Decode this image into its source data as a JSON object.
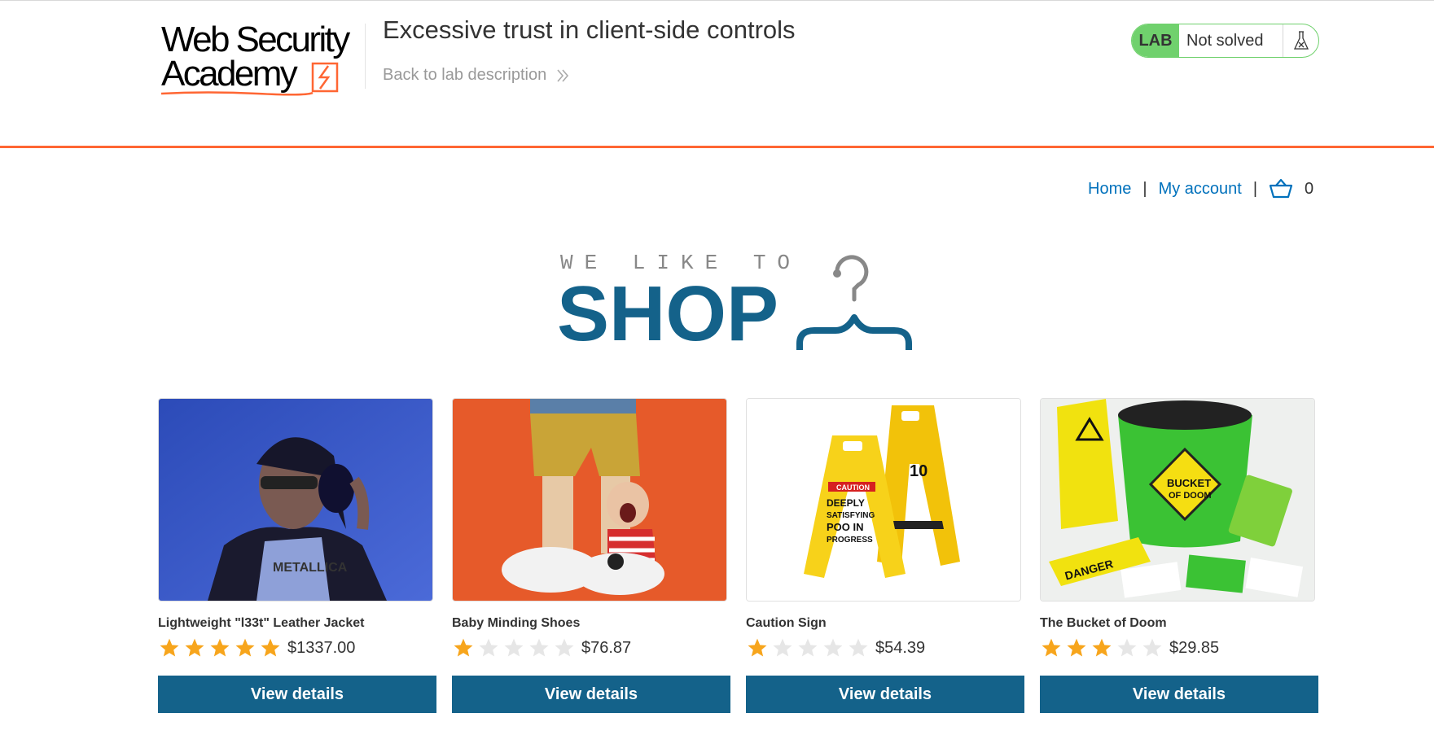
{
  "header": {
    "logo_line1": "Web Security",
    "logo_line2": "Academy",
    "lab_title": "Excessive trust in client-side controls",
    "back_link": "Back to lab description",
    "lab_badge": "LAB",
    "lab_status": "Not solved"
  },
  "nav": {
    "home": "Home",
    "separator": "|",
    "my_account": "My account",
    "cart_count": "0"
  },
  "banner": {
    "small": "WE LIKE TO",
    "big": "SHOP"
  },
  "colors": {
    "accent_orange": "#ff6633",
    "primary_blue": "#14628a",
    "link_blue": "#0071bc",
    "lab_green": "#70d16d",
    "star_gold": "#f7a51c"
  },
  "products": [
    {
      "name": "Lightweight \"l33t\" Leather Jacket",
      "rating": 5,
      "price": "$1337.00",
      "button": "View details"
    },
    {
      "name": "Baby Minding Shoes",
      "rating": 1,
      "price": "$76.87",
      "button": "View details"
    },
    {
      "name": "Caution Sign",
      "rating": 1,
      "price": "$54.39",
      "button": "View details"
    },
    {
      "name": "The Bucket of Doom",
      "rating": 3,
      "price": "$29.85",
      "button": "View details"
    }
  ]
}
